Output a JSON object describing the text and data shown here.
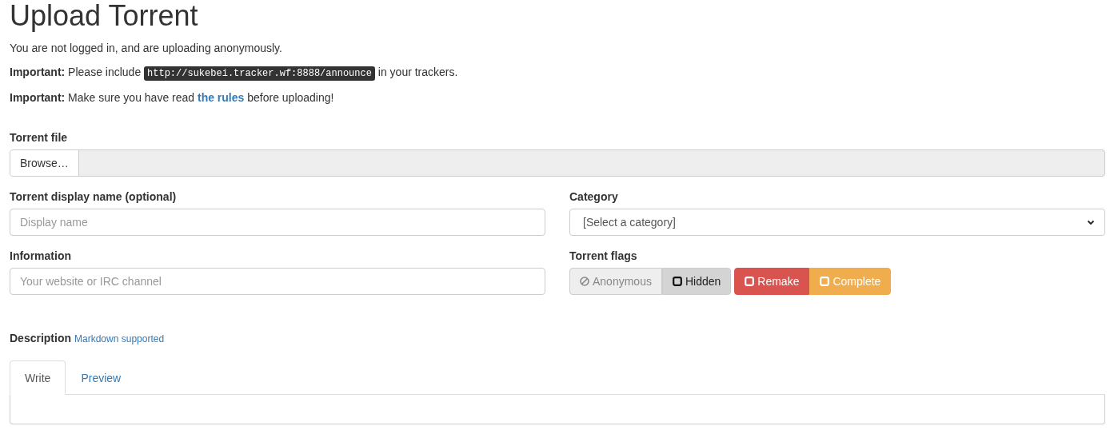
{
  "title": "Upload Torrent",
  "notices": [
    {
      "before": "You are not logged in, and are uploading anonymously."
    },
    {
      "before": "**Important:** Please include ",
      "code": "http://sukebei.tracker.wf:8888/announce",
      "after": " in your trackers."
    },
    {
      "before": "**Important:** Make sure you have read ",
      "link": "the rules",
      "after": " before uploading!"
    }
  ],
  "torrent_file": {
    "label": "Torrent file",
    "button": "Browse…"
  },
  "display_name": {
    "label": "Torrent display name (optional)",
    "placeholder": "Display name"
  },
  "category": {
    "label": "Category",
    "value": "[Select a category]"
  },
  "information": {
    "label": "Information",
    "placeholder": "Your website or IRC channel"
  },
  "flags": {
    "label": "Torrent flags",
    "items": [
      {
        "label": "Anonymous",
        "kind": "ban",
        "disabled": true,
        "color": "#eeeeee"
      },
      {
        "label": "Hidden",
        "kind": "checkbox",
        "disabled": false,
        "color": "#d4d4d4"
      },
      {
        "label": "Remake",
        "kind": "checkbox",
        "disabled": false,
        "color": "#d9534f"
      },
      {
        "label": "Complete",
        "kind": "checkbox",
        "disabled": false,
        "color": "#f0ad4e"
      }
    ]
  },
  "description": {
    "label": "Description",
    "hint": "Markdown supported",
    "tabs": [
      {
        "label": "Write",
        "selected": true
      },
      {
        "label": "Preview",
        "selected": false
      }
    ]
  }
}
